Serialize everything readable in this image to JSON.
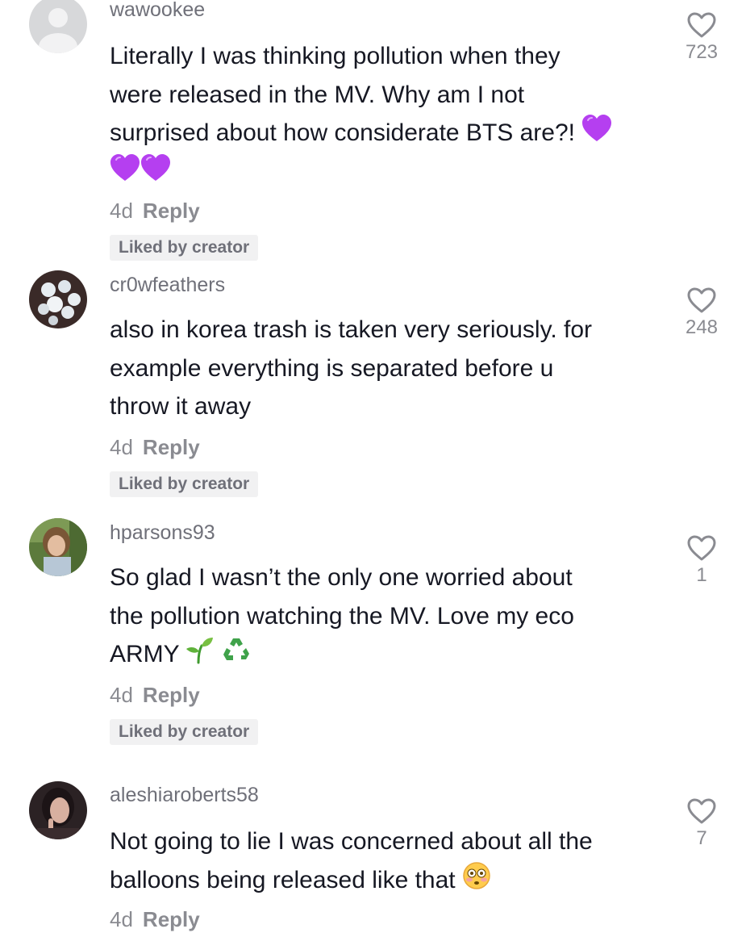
{
  "comments": [
    {
      "username": "wawookee",
      "lines": [
        "Literally I was thinking pollution when they",
        "were released in the MV. Why am I not",
        "surprised about how considerate BTS are?!"
      ],
      "emoji_line_1": [
        "purple-heart-icon"
      ],
      "emoji_line_2": [
        "purple-heart-icon",
        "purple-heart-icon"
      ],
      "time": "4d",
      "reply": "Reply",
      "liked_by_creator": "Liked by creator",
      "likes": "723"
    },
    {
      "username": "cr0wfeathers",
      "lines": [
        "also in korea trash is taken very seriously. for",
        "example everything is separated before u",
        "throw it away"
      ],
      "time": "4d",
      "reply": "Reply",
      "liked_by_creator": "Liked by creator",
      "likes": "248"
    },
    {
      "username": "hparsons93",
      "lines": [
        "So glad I wasn’t the only one worried about",
        "the pollution watching the MV. Love my eco",
        "ARMY"
      ],
      "emoji": [
        "seedling-icon",
        "recycle-icon"
      ],
      "time": "4d",
      "reply": "Reply",
      "liked_by_creator": "Liked by creator",
      "likes": "1"
    },
    {
      "username": "aleshiaroberts58",
      "lines": [
        "Not going to lie I was concerned about all the",
        "balloons being released like that"
      ],
      "emoji": [
        "flushed-face-icon"
      ],
      "time": "4d",
      "reply": "Reply",
      "likes": "7"
    }
  ],
  "colors": {
    "text": "#161823",
    "username": "#6f7079",
    "meta": "#8a8b91",
    "badge_bg": "#f1f1f2",
    "heart_emoji": "#b53ff0"
  }
}
